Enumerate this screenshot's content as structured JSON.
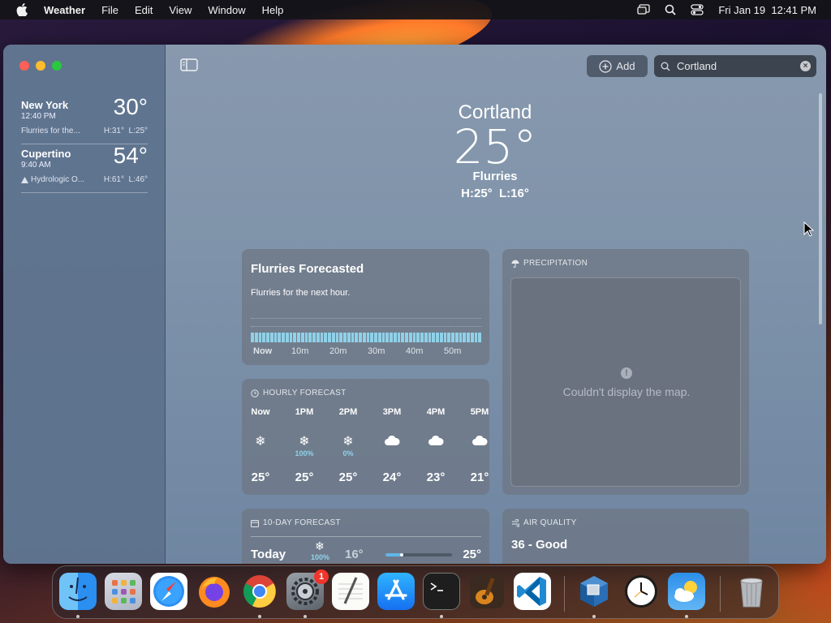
{
  "menubar": {
    "app_name": "Weather",
    "menus": [
      "File",
      "Edit",
      "View",
      "Window",
      "Help"
    ],
    "datetime": "Fri Jan 19  12:41 PM"
  },
  "sidebar": {
    "locations": [
      {
        "name": "New York",
        "time": "12:40 PM",
        "temp": "30°",
        "condition": "Flurries for the...",
        "hilo": "H:31°  L:25°"
      },
      {
        "name": "Cupertino",
        "time": "9:40 AM",
        "temp": "54°",
        "condition": "Hydrologic O...",
        "hilo": "H:61°  L:46°"
      }
    ]
  },
  "toolbar": {
    "add_label": "Add",
    "search_value": "Cortland"
  },
  "current": {
    "city": "Cortland",
    "temp": "25°",
    "condition": "Flurries",
    "hilo": "H:25°  L:16°"
  },
  "flurries_card": {
    "title": "Flurries Forecasted",
    "subtitle": "Flurries for the next hour.",
    "axis": [
      "Now",
      "10m",
      "20m",
      "30m",
      "40m",
      "50m"
    ]
  },
  "hourly": {
    "header": "HOURLY FORECAST",
    "hours": [
      {
        "label": "Now",
        "icon": "snowflake-icon",
        "pct": "",
        "temp": "25°"
      },
      {
        "label": "1PM",
        "icon": "snowflake-icon",
        "pct": "100%",
        "temp": "25°"
      },
      {
        "label": "2PM",
        "icon": "snowflake-icon",
        "pct": "0%",
        "temp": "25°"
      },
      {
        "label": "3PM",
        "icon": "cloud-icon",
        "pct": "",
        "temp": "24°"
      },
      {
        "label": "4PM",
        "icon": "cloud-icon",
        "pct": "",
        "temp": "23°"
      },
      {
        "label": "5PM",
        "icon": "cloud-icon",
        "pct": "",
        "temp": "21°"
      }
    ]
  },
  "precipitation": {
    "header": "PRECIPITATION",
    "message": "Couldn't display the map."
  },
  "ten_day": {
    "header": "10-DAY FORECAST",
    "rows": [
      {
        "day": "Today",
        "pct": "100%",
        "low": "16°",
        "high": "25°"
      }
    ]
  },
  "air_quality": {
    "header": "AIR QUALITY",
    "value": "36 - Good"
  },
  "dock": {
    "apps": [
      "Finder",
      "Launchpad",
      "Safari",
      "Firefox",
      "Chrome",
      "System Settings",
      "TextEdit",
      "App Store",
      "Terminal",
      "GarageBand",
      "Visual Studio Code",
      "VirtualBox",
      "Clock",
      "Weather",
      "Trash"
    ],
    "settings_badge": "1"
  },
  "colors": {
    "accent_blue": "#8fd1e8",
    "close": "#ff5f57",
    "minimize": "#febc2e",
    "zoom": "#28c840"
  }
}
